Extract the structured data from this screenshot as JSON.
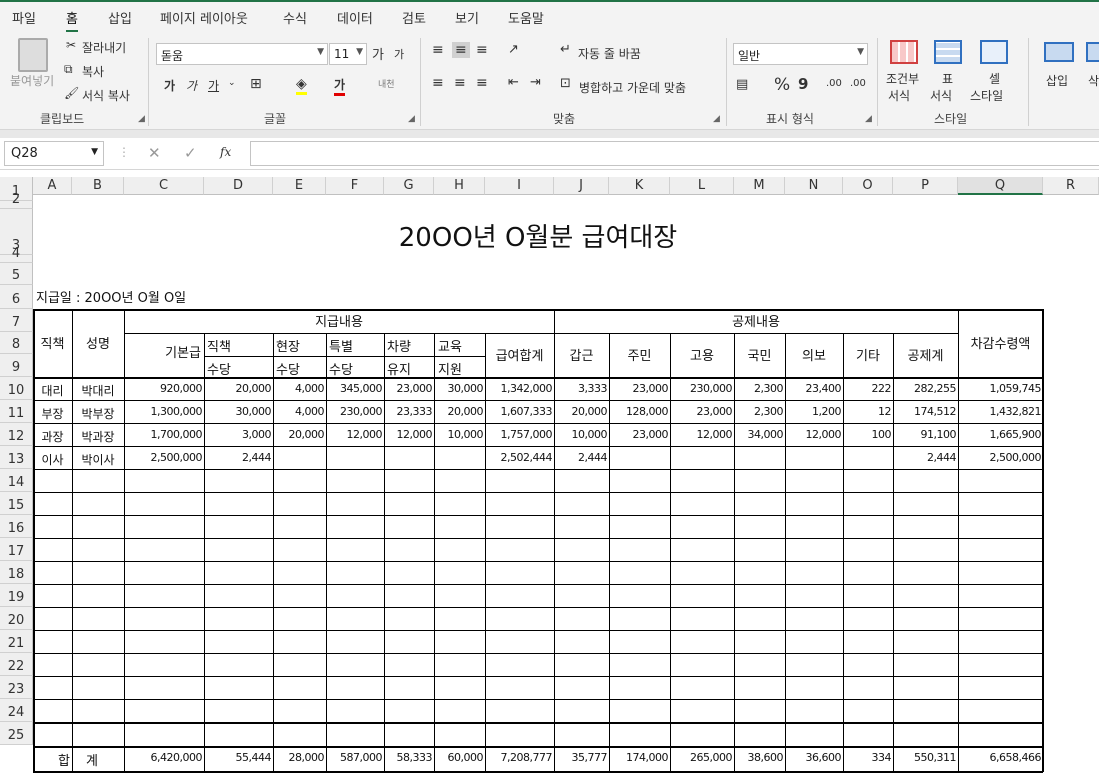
{
  "menu": {
    "tabs": [
      "파일",
      "홈",
      "삽입",
      "페이지 레이아웃",
      "수식",
      "데이터",
      "검토",
      "보기",
      "도움말"
    ]
  },
  "ribbon": {
    "clipboard": {
      "paste": "붙여넣기",
      "cut": "잘라내기",
      "copy": "복사",
      "format_painter": "서식 복사",
      "label": "클립보드"
    },
    "font": {
      "name": "돋움",
      "size": "11",
      "bold": "가",
      "italic": "가",
      "underline": "가",
      "grow": "가",
      "shrink": "가",
      "font_color": "가",
      "phonetic": "내천",
      "label": "글꼴"
    },
    "align": {
      "wrap": "자동 줄 바꿈",
      "merge": "병합하고 가운데 맞춤",
      "label": "맞춤"
    },
    "number": {
      "format": "일반",
      "percent": "%",
      "comma": "9",
      "inc": ".00",
      "dec": ".00",
      "label": "표시 형식"
    },
    "styles": {
      "cond1": "조건부",
      "cond2": "서식",
      "table1": "표",
      "table2": "서식",
      "cell1": "셀",
      "cell2": "스타일",
      "label": "스타일"
    },
    "cells": {
      "insert": "삽입",
      "delete": "삭"
    }
  },
  "formula_bar": {
    "name_box": "Q28",
    "fx": "fx"
  },
  "columns": [
    "A",
    "B",
    "C",
    "D",
    "E",
    "F",
    "G",
    "H",
    "I",
    "J",
    "K",
    "L",
    "M",
    "N",
    "O",
    "P",
    "Q",
    "R"
  ],
  "rows": [
    "1",
    "2",
    "3",
    "4",
    "5",
    "6",
    "7",
    "8",
    "9",
    "10",
    "11",
    "12",
    "13",
    "14",
    "15",
    "16",
    "17",
    "18",
    "19",
    "20",
    "21",
    "22",
    "23",
    "24",
    "25"
  ],
  "sheet": {
    "title": "20OO년 O월분 급여대장",
    "date": "지급일 : 20OO년 O월 O일",
    "headers": {
      "position": "직책",
      "name": "성명",
      "pay_group": "지급내용",
      "base": "기본급",
      "pos1": "직책",
      "pos2": "수당",
      "site1": "현장",
      "site2": "수당",
      "spec1": "특별",
      "spec2": "수당",
      "car1": "차량",
      "car2": "유지",
      "edu1": "교육",
      "edu2": "지원",
      "pay_total": "급여합계",
      "ded_group": "공제내용",
      "income": "갑근",
      "resident": "주민",
      "employ": "고용",
      "pension": "국민",
      "health": "의보",
      "etc": "기타",
      "ded_total": "공제계",
      "net": "차감수령액"
    },
    "data": [
      [
        "대리",
        "박대리",
        "920,000",
        "20,000",
        "4,000",
        "345,000",
        "23,000",
        "30,000",
        "1,342,000",
        "3,333",
        "23,000",
        "230,000",
        "2,300",
        "23,400",
        "222",
        "282,255",
        "1,059,745"
      ],
      [
        "부장",
        "박부장",
        "1,300,000",
        "30,000",
        "4,000",
        "230,000",
        "23,333",
        "20,000",
        "1,607,333",
        "20,000",
        "128,000",
        "23,000",
        "2,300",
        "1,200",
        "12",
        "174,512",
        "1,432,821"
      ],
      [
        "과장",
        "박과장",
        "1,700,000",
        "3,000",
        "20,000",
        "12,000",
        "12,000",
        "10,000",
        "1,757,000",
        "10,000",
        "23,000",
        "12,000",
        "34,000",
        "12,000",
        "100",
        "91,100",
        "1,665,900"
      ],
      [
        "이사",
        "박이사",
        "2,500,000",
        "2,444",
        "",
        "",
        "",
        "",
        "2,502,444",
        "2,444",
        "",
        "",
        "",
        "",
        "",
        "2,444",
        "2,500,000"
      ]
    ],
    "total": {
      "label1": "합",
      "label2": "계",
      "values": [
        "6,420,000",
        "55,444",
        "28,000",
        "587,000",
        "58,333",
        "60,000",
        "7,208,777",
        "35,777",
        "174,000",
        "265,000",
        "38,600",
        "36,600",
        "334",
        "550,311",
        "6,658,466"
      ]
    }
  }
}
